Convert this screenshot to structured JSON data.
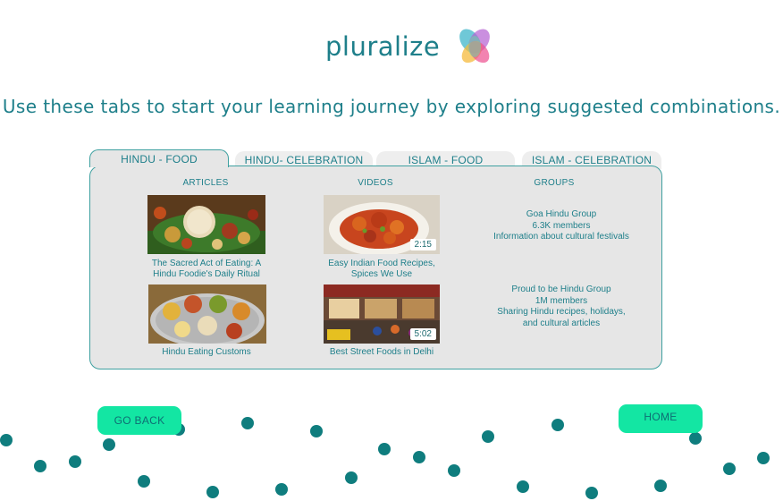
{
  "brand": {
    "name": "pluralize",
    "mark": "pluralize-logo-icon"
  },
  "headline": "Use these tabs to start your learning journey by exploring suggested combinations.",
  "tabs": [
    {
      "label": "HINDU - FOOD",
      "active": true
    },
    {
      "label": "HINDU- CELEBRATION",
      "active": false
    },
    {
      "label": "ISLAM - FOOD",
      "active": false
    },
    {
      "label": "ISLAM - CELEBRATION",
      "active": false
    }
  ],
  "columns": {
    "articles": "ARTICLES",
    "videos": "VIDEOS",
    "groups": "GROUPS"
  },
  "articles": [
    {
      "title_line1": "The Sacred Act of Eating: A",
      "title_line2": "Hindu Foodie's Daily Ritual"
    },
    {
      "title_line1": "Hindu Eating Customs"
    }
  ],
  "videos": [
    {
      "title_line1": "Easy Indian Food Recipes,",
      "title_line2": "Spices We Use",
      "duration": "2:15"
    },
    {
      "title_line1": "Best Street Foods in Delhi",
      "duration": "5:02"
    }
  ],
  "groups": [
    {
      "name": "Goa Hindu Group",
      "members": "6.3K members",
      "desc_line1": "Information about cultural festivals"
    },
    {
      "name": "Proud to be Hindu Group",
      "members": "1M members",
      "desc_line1": "Sharing Hindu recipes, holidays,",
      "desc_line2": "and cultural articles"
    }
  ],
  "buttons": {
    "back": "GO BACK",
    "home": "HOME"
  },
  "colors": {
    "teal_text": "#1e7f8a",
    "panel_bg": "#e6e6e6",
    "panel_border": "#3fa0a0",
    "button": "#13e6a3",
    "dot": "#0f7d7e"
  }
}
